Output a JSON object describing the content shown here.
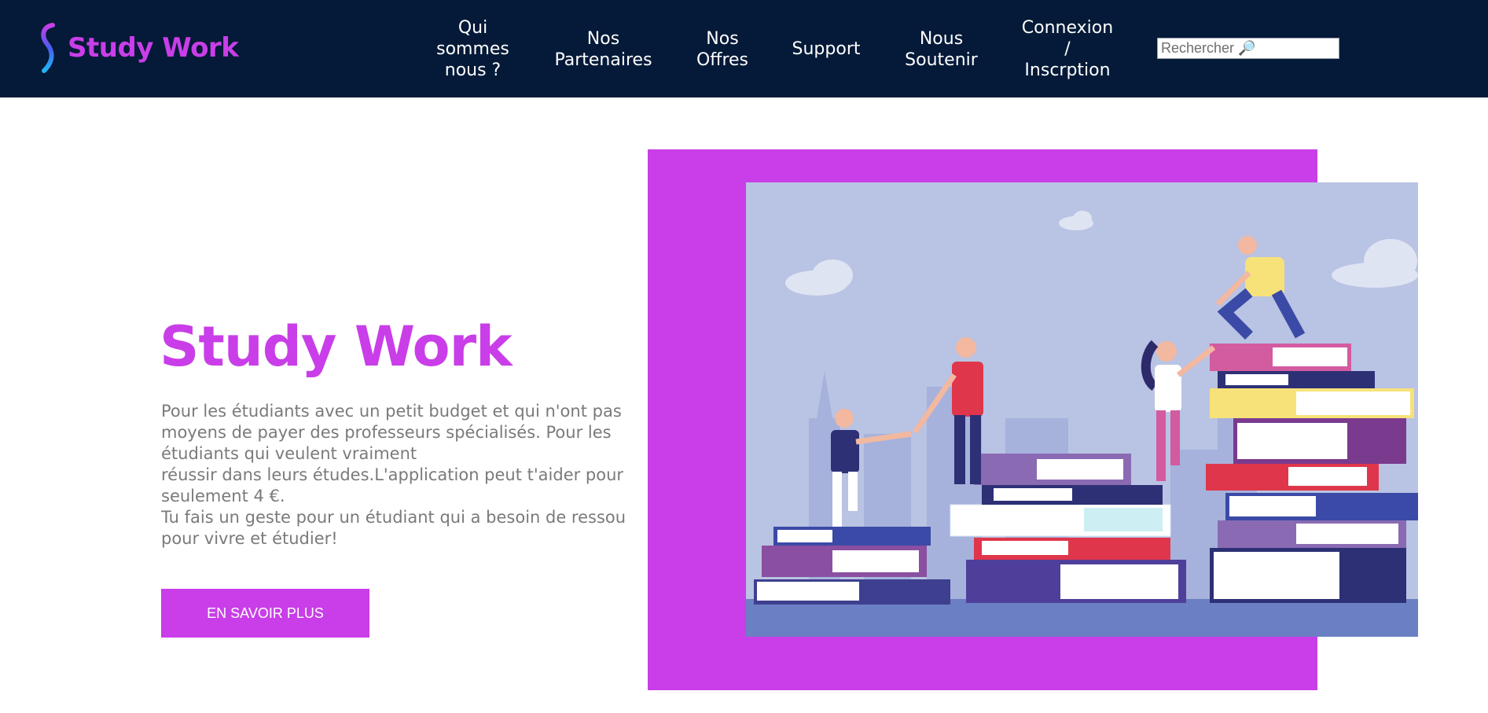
{
  "header": {
    "logo_text": "Study Work",
    "nav": [
      {
        "lines": [
          "Qui",
          "sommes",
          "nous ?"
        ]
      },
      {
        "lines": [
          "Nos",
          "Partenaires"
        ]
      },
      {
        "lines": [
          "Nos",
          "Offres"
        ]
      },
      {
        "lines": [
          "Support"
        ]
      },
      {
        "lines": [
          "Nous",
          "Soutenir"
        ]
      },
      {
        "lines": [
          "Connexion",
          "/",
          "Inscrption"
        ]
      }
    ],
    "search": {
      "placeholder": "Rechercher 🔎",
      "icon": "magnifier-icon"
    }
  },
  "hero": {
    "title": "Study Work",
    "paragraph_lines": [
      "Pour les étudiants avec un petit budget et qui n'ont pas",
      "moyens de payer des professeurs spécialisés. Pour les",
      "étudiants qui veulent vraiment",
      "réussir dans leurs études.L'application peut t'aider pour",
      "seulement 4 €.",
      "Tu fais un geste pour un étudiant qui a besoin de ressou",
      "pour vivre et étudier!"
    ],
    "cta_label": "EN SAVOIR PLUS"
  },
  "colors": {
    "navbar_bg": "#041a38",
    "accent": "#c93ee8",
    "body_text": "#7a7a7a",
    "illustration_sky": "#b9c3e3"
  }
}
